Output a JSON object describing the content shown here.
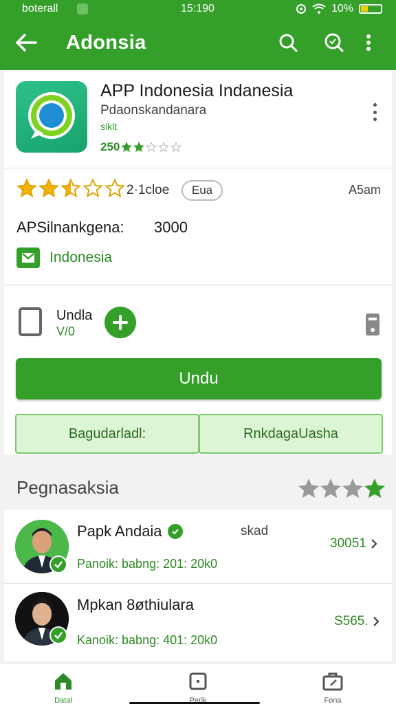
{
  "status": {
    "carrier": "boterall",
    "time": "15:190",
    "battery": "10%"
  },
  "appbar": {
    "title": "Adonsia"
  },
  "app": {
    "title": "APP Indonesia Indanesia",
    "developer": "Pdaonskandanara",
    "tag": "siklt",
    "rating_text": "250",
    "rating_stars": 2,
    "star_count_total": 5
  },
  "rating_row": {
    "stars_filled": 2.5,
    "count": "2·1cloe",
    "pill": "Eua",
    "age": "A5am"
  },
  "meta": {
    "key": "APSilnankgena:",
    "value": "3000",
    "country": "Indonesia"
  },
  "download": {
    "label": "Undla",
    "version": "V/0"
  },
  "buttons": {
    "primary": "Undu",
    "left": "Bagudarladl:",
    "right": "RnkdagaUasha"
  },
  "reviews": {
    "title": "Pegnasaksia",
    "header_stars": 4,
    "items": [
      {
        "name": "Papk Andaia",
        "tag": "skad",
        "sub": "Panoik: babng: 201: 20k0",
        "count": "30051"
      },
      {
        "name": "Mpkan 8øthiulara",
        "tag": "",
        "sub": "Kanoik: babng: 401: 20k0",
        "count": "S565."
      }
    ]
  },
  "bottom_nav": [
    {
      "label": "Datal",
      "icon": "home-icon"
    },
    {
      "label": "Perik",
      "icon": "square-icon"
    },
    {
      "label": "Fona",
      "icon": "briefcase-icon"
    }
  ],
  "colors": {
    "accent": "#34a02a",
    "accent_light": "#dcf5d4",
    "star": "#f4b400"
  }
}
